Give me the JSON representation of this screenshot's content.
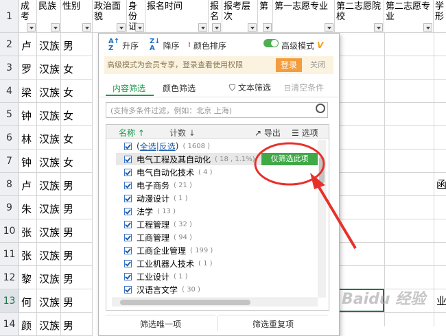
{
  "columns": [
    "成考",
    "民族",
    "性别",
    "政治面貌",
    "身份证",
    "报名时间",
    "报名",
    "报考层次",
    "第",
    "第一志愿专业",
    "第二志愿院校",
    "第二志愿专业",
    "学形"
  ],
  "row_numbers": [
    "1",
    "2",
    "3",
    "4",
    "5",
    "6",
    "7",
    "8",
    "9",
    "10",
    "11",
    "12",
    "13",
    "14"
  ],
  "rows": [
    {
      "name": "卢",
      "ethnic": "汉族",
      "gender": "男"
    },
    {
      "name": "罗",
      "ethnic": "汉族",
      "gender": "女"
    },
    {
      "name": "梁",
      "ethnic": "汉族",
      "gender": "女"
    },
    {
      "name": "钟",
      "ethnic": "汉族",
      "gender": "女"
    },
    {
      "name": "林",
      "ethnic": "汉族",
      "gender": "女"
    },
    {
      "name": "钟",
      "ethnic": "汉族",
      "gender": "女"
    },
    {
      "name": "卢",
      "ethnic": "汉族",
      "gender": "男"
    },
    {
      "name": "朱",
      "ethnic": "汉族",
      "gender": "男"
    },
    {
      "name": "张",
      "ethnic": "汉族",
      "gender": "男"
    },
    {
      "name": "张",
      "ethnic": "汉族",
      "gender": "男"
    },
    {
      "name": "黎",
      "ethnic": "汉族",
      "gender": "男"
    },
    {
      "name": "何",
      "ethnic": "汉族",
      "gender": "男"
    },
    {
      "name": "颜",
      "ethnic": "汉族",
      "gender": "男"
    }
  ],
  "right_cells": {
    "row8": "函",
    "row13": "业"
  },
  "selected_row": "13",
  "panel": {
    "sort_asc": "升序",
    "sort_desc": "降序",
    "color_sort": "颜色排序",
    "advanced": "高级模式",
    "banner": "高级模式为会员专享，登录查看使用权限",
    "login": "登录",
    "close": "关闭",
    "tab_content": "内容筛选",
    "tab_color": "颜色筛选",
    "text_filter": "文本筛选",
    "clear": "清空条件",
    "search_placeholder": "(支持多条件过滤，例如：北京  上海)",
    "col_name": "名称",
    "col_count": "计数",
    "export": "导出",
    "options": "选项",
    "select_all": "全选",
    "invert": "反选",
    "total": "( 1608 )",
    "only_this": "仅筛选此项",
    "btn_unique": "筛选唯一项",
    "btn_dup": "筛选重复项"
  },
  "items": [
    {
      "label": "电气工程及其自动化",
      "count": "( 18 , 1.1%)"
    },
    {
      "label": "电气自动化技术",
      "count": "( 4 )"
    },
    {
      "label": "电子商务",
      "count": "( 21 )"
    },
    {
      "label": "动漫设计",
      "count": "( 1 )"
    },
    {
      "label": "法学",
      "count": "( 13 )"
    },
    {
      "label": "工程管理",
      "count": "( 32 )"
    },
    {
      "label": "工商管理",
      "count": "( 94 )"
    },
    {
      "label": "工商企业管理",
      "count": "( 199 )"
    },
    {
      "label": "工业机器人技术",
      "count": "( 1 )"
    },
    {
      "label": "工业设计",
      "count": "( 1 )"
    },
    {
      "label": "汉语言文学",
      "count": "( 30 )"
    }
  ],
  "watermark": "Baidu 经验",
  "colors": {
    "accent": "#3fa946",
    "annotation": "#e8302a",
    "login": "#f39d3e"
  }
}
